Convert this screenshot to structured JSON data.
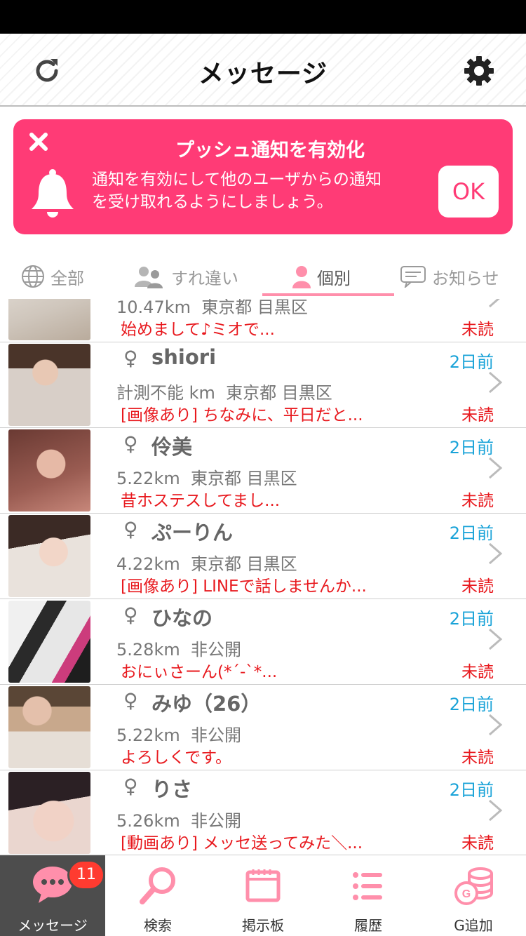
{
  "header": {
    "title": "メッセージ"
  },
  "banner": {
    "title": "プッシュ通知を有効化",
    "line1": "通知を有効にして他のユーザからの通知",
    "line2": "を受け取れるようにしましょう。",
    "ok_label": "OK",
    "color": "#ff3b76"
  },
  "tabs": [
    {
      "label": "全部",
      "icon": "globe-users-icon"
    },
    {
      "label": "すれ違い",
      "icon": "passing-users-icon"
    },
    {
      "label": "個別",
      "icon": "person-icon",
      "active": true
    },
    {
      "label": "お知らせ",
      "icon": "chat-bubble-icon"
    }
  ],
  "messages": [
    {
      "name": "",
      "distance": "10.47km",
      "location": "東京都 目黒区",
      "preview": "始めまして♪ミオで...",
      "time": "",
      "status": "未読"
    },
    {
      "name": "shiori",
      "gender": "♀",
      "distance": "計測不能 km",
      "location": "東京都 目黒区",
      "preview": "[画像あり] ちなみに、平日だと...",
      "time": "2日前",
      "status": "未読"
    },
    {
      "name": "伶美",
      "gender": "♀",
      "distance": "5.22km",
      "location": "東京都 目黒区",
      "preview": "昔ホステスしてまし...",
      "time": "2日前",
      "status": "未読"
    },
    {
      "name": "ぷーりん",
      "gender": "♀",
      "distance": "4.22km",
      "location": "東京都 目黒区",
      "preview": "[画像あり] LINEで話しませんか...",
      "time": "2日前",
      "status": "未読"
    },
    {
      "name": "ひなの",
      "gender": "♀",
      "distance": "5.28km",
      "location": "非公開",
      "preview": "おにぃさーん(*´-`*...",
      "time": "2日前",
      "status": "未読"
    },
    {
      "name": "みゆ（26）",
      "gender": "♀",
      "distance": "5.22km",
      "location": "非公開",
      "preview": "よろしくです。",
      "time": "2日前",
      "status": "未読"
    },
    {
      "name": "りさ",
      "gender": "♀",
      "distance": "5.26km",
      "location": "非公開",
      "preview": "[動画あり] メッセ送ってみた＼...",
      "time": "2日前",
      "status": "未読"
    }
  ],
  "tabbar": {
    "items": [
      {
        "label": "メッセージ",
        "icon": "chat-bubble-icon",
        "badge": "11",
        "active": true
      },
      {
        "label": "検索",
        "icon": "search-icon"
      },
      {
        "label": "掲示板",
        "icon": "bulletin-board-icon"
      },
      {
        "label": "履歴",
        "icon": "list-icon"
      },
      {
        "label": "G追加",
        "icon": "coins-icon"
      }
    ]
  },
  "colors": {
    "accent": "#ff3b76",
    "time": "#1aa3d8",
    "unread": "#e8191e",
    "icon_pink": "#ff8fab"
  }
}
